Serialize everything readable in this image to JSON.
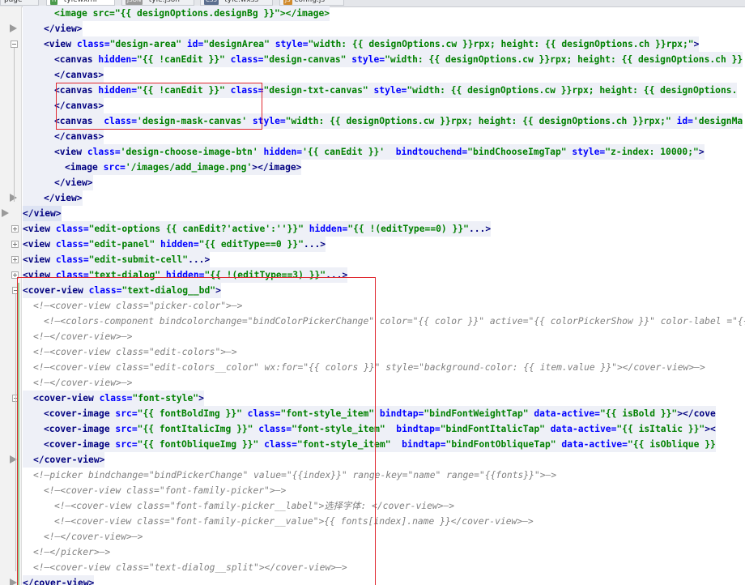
{
  "tabs": [
    {
      "label": "page",
      "icon": "",
      "color": "#6a8ed1"
    },
    {
      "label": "*tylewxml",
      "icon": "H",
      "color": "#4a9a4a"
    },
    {
      "label": "*tyle.json",
      "icon": "JSON",
      "color": "#999999"
    },
    {
      "label": "*tyle.wxss",
      "icon": "CSS",
      "color": "#5b6e8e"
    },
    {
      "label": "config.js",
      "icon": "JS",
      "color": "#d08a2a"
    }
  ],
  "colors": {
    "tag": "#000080",
    "attribute": "#0000ff",
    "value": "#008000",
    "comment": "#808080",
    "annotation": "#e0282f",
    "gutter_change": "#96cf96"
  },
  "code_lines": [
    {
      "kind": "hl",
      "indent": 6,
      "tokens": [
        [
          "v",
          "<image src=\"{{ designOptions.designBg }}\"></image>"
        ]
      ]
    },
    {
      "kind": "hl",
      "indent": 4,
      "tokens": [
        [
          "t",
          "</view>"
        ]
      ]
    },
    {
      "kind": "hl",
      "indent": 4,
      "tokens": [
        [
          "t",
          "<view "
        ],
        [
          "a",
          "class="
        ],
        [
          "v",
          "\"design-area\""
        ],
        [
          "a",
          " id="
        ],
        [
          "v",
          "\"designArea\""
        ],
        [
          "a",
          " style="
        ],
        [
          "v",
          "\"width: {{ designOptions.cw }}rpx; height: {{ designOptions.ch }}rpx;\""
        ],
        [
          "t",
          ">"
        ]
      ]
    },
    {
      "kind": "hl",
      "indent": 6,
      "tokens": [
        [
          "t",
          "<canvas "
        ],
        [
          "a",
          "hidden="
        ],
        [
          "v",
          "\"{{ !canEdit }}\""
        ],
        [
          "a",
          " class="
        ],
        [
          "v",
          "\"design-canvas\""
        ],
        [
          "a",
          " style="
        ],
        [
          "v",
          "\"width: {{ designOptions.cw }}rpx; height: {{ designOptions.ch }}"
        ]
      ]
    },
    {
      "kind": "hl",
      "indent": 6,
      "tokens": [
        [
          "t",
          "</canvas>"
        ]
      ]
    },
    {
      "kind": "hl",
      "indent": 6,
      "tokens": [
        [
          "t",
          "<canvas "
        ],
        [
          "a",
          "hidden="
        ],
        [
          "v",
          "\"{{ !canEdit }}\""
        ],
        [
          "a",
          " class="
        ],
        [
          "v",
          "\"design-txt-canvas\""
        ],
        [
          "a",
          " style="
        ],
        [
          "v",
          "\"width: {{ designOptions.cw }}rpx; height: {{ designOptions."
        ]
      ]
    },
    {
      "kind": "hl",
      "indent": 6,
      "tokens": [
        [
          "t",
          "</canvas>"
        ]
      ]
    },
    {
      "kind": "hl",
      "indent": 6,
      "tokens": [
        [
          "t",
          "<canvas  "
        ],
        [
          "a",
          "class="
        ],
        [
          "v",
          "'design-mask-canvas'"
        ],
        [
          "a",
          " style="
        ],
        [
          "v",
          "\"width: {{ designOptions.cw }}rpx; height: {{ designOptions.ch }}rpx;\""
        ],
        [
          "a",
          " id="
        ],
        [
          "v",
          "'designMa"
        ]
      ]
    },
    {
      "kind": "hl",
      "indent": 6,
      "tokens": [
        [
          "t",
          "</canvas>"
        ]
      ]
    },
    {
      "kind": "hl",
      "indent": 6,
      "tokens": [
        [
          "t",
          "<view "
        ],
        [
          "a",
          "class="
        ],
        [
          "v",
          "'design-choose-image-btn'"
        ],
        [
          "a",
          " hidden="
        ],
        [
          "v",
          "'{{ canEdit }}'"
        ],
        [
          "a",
          "  bindtouchend="
        ],
        [
          "v",
          "\"bindChooseImgTap\""
        ],
        [
          "a",
          " style="
        ],
        [
          "v",
          "\"z-index: 10000;\""
        ],
        [
          "t",
          ">"
        ]
      ]
    },
    {
      "kind": "hl",
      "indent": 8,
      "tokens": [
        [
          "t",
          "<image "
        ],
        [
          "a",
          "src="
        ],
        [
          "v",
          "'/images/add_image.png'"
        ],
        [
          "t",
          "></image>"
        ]
      ]
    },
    {
      "kind": "hl",
      "indent": 6,
      "tokens": [
        [
          "t",
          "</view>"
        ]
      ]
    },
    {
      "kind": "hl",
      "indent": 4,
      "tokens": [
        [
          "t",
          "</view>"
        ]
      ]
    },
    {
      "kind": "cur",
      "indent": 0,
      "tokens": [
        [
          "t",
          "</view>"
        ]
      ]
    },
    {
      "kind": "hl",
      "indent": 0,
      "tokens": [
        [
          "t",
          "<view "
        ],
        [
          "a",
          "class="
        ],
        [
          "v",
          "\"edit-options {{ canEdit?'active':''}}\""
        ],
        [
          "a",
          " hidden="
        ],
        [
          "v",
          "\"{{ !(editType==0) }}\""
        ],
        [
          "t",
          "..."
        ],
        [
          "t",
          ">"
        ]
      ]
    },
    {
      "kind": "hl",
      "indent": 0,
      "tokens": [
        [
          "t",
          "<view "
        ],
        [
          "a",
          "class="
        ],
        [
          "v",
          "\"edit-panel\""
        ],
        [
          "a",
          " hidden="
        ],
        [
          "v",
          "\"{{ editType==0 }}\""
        ],
        [
          "t",
          "...>"
        ]
      ]
    },
    {
      "kind": "hl",
      "indent": 0,
      "tokens": [
        [
          "t",
          "<view "
        ],
        [
          "a",
          "class="
        ],
        [
          "v",
          "\"edit-submit-cell\""
        ],
        [
          "t",
          "...>"
        ]
      ]
    },
    {
      "kind": "hl",
      "indent": 0,
      "tokens": [
        [
          "t",
          "<view "
        ],
        [
          "a",
          "class="
        ],
        [
          "v",
          "\"text-dialog\""
        ],
        [
          "a",
          " hidden="
        ],
        [
          "v",
          "\"{{ !(editType==3) }}\""
        ],
        [
          "t",
          "...>"
        ]
      ]
    },
    {
      "kind": "hl",
      "indent": 0,
      "tokens": [
        [
          "t",
          "<cover-view "
        ],
        [
          "a",
          "class="
        ],
        [
          "v",
          "\"text-dialog__bd\""
        ],
        [
          "t",
          ">"
        ]
      ]
    },
    {
      "kind": "cmt",
      "indent": 2,
      "tokens": [
        [
          "c",
          "<!—<cover-view class=\"picker-color\">—>"
        ]
      ]
    },
    {
      "kind": "cmt",
      "indent": 4,
      "tokens": [
        [
          "c",
          "<!—<colors-component bindcolorchange=\"bindColorPickerChange\" color=\"{{ color }}\" active=\"{{ colorPickerShow }}\" color-label =\"{{ false }}\" c"
        ]
      ]
    },
    {
      "kind": "cmt",
      "indent": 2,
      "tokens": [
        [
          "c",
          "<!—</cover-view>—>"
        ]
      ]
    },
    {
      "kind": "cmt",
      "indent": 2,
      "tokens": [
        [
          "c",
          "<!—<cover-view class=\"edit-colors\">—>"
        ]
      ]
    },
    {
      "kind": "cmt",
      "indent": 2,
      "tokens": [
        [
          "c",
          "<!—<cover-view class=\"edit-colors__color\" wx:for=\"{{ colors }}\" style=\"background-color: {{ item.value }}\"></cover-view>—>"
        ]
      ]
    },
    {
      "kind": "cmt",
      "indent": 2,
      "tokens": [
        [
          "c",
          "<!—</cover-view>—>"
        ]
      ]
    },
    {
      "kind": "hl",
      "indent": 2,
      "tokens": [
        [
          "t",
          "<cover-view "
        ],
        [
          "a",
          "class="
        ],
        [
          "v",
          "\"font-style\""
        ],
        [
          "t",
          ">"
        ]
      ]
    },
    {
      "kind": "hl",
      "indent": 4,
      "tokens": [
        [
          "t",
          "<cover-image "
        ],
        [
          "a",
          "src="
        ],
        [
          "v",
          "\"{{ fontBoldImg }}\""
        ],
        [
          "a",
          " class="
        ],
        [
          "v",
          "\"font-style_item\""
        ],
        [
          "a",
          " bindtap="
        ],
        [
          "v",
          "\"bindFontWeightTap\""
        ],
        [
          "a",
          " data-active="
        ],
        [
          "v",
          "\"{{ isBold }}\""
        ],
        [
          "t",
          "></cove"
        ]
      ]
    },
    {
      "kind": "hl",
      "indent": 4,
      "tokens": [
        [
          "t",
          "<cover-image "
        ],
        [
          "a",
          "src="
        ],
        [
          "v",
          "\"{{ fontItalicImg }}\""
        ],
        [
          "a",
          " class="
        ],
        [
          "v",
          "\"font-style_item\""
        ],
        [
          "a",
          "  bindtap="
        ],
        [
          "v",
          "\"bindFontItalicTap\""
        ],
        [
          "a",
          " data-active="
        ],
        [
          "v",
          "\"{{ isItalic }}\""
        ],
        [
          "t",
          "><"
        ]
      ]
    },
    {
      "kind": "hl",
      "indent": 4,
      "tokens": [
        [
          "t",
          "<cover-image "
        ],
        [
          "a",
          "src="
        ],
        [
          "v",
          "\"{{ fontObliqueImg }}\""
        ],
        [
          "a",
          " class="
        ],
        [
          "v",
          "\"font-style_item\""
        ],
        [
          "a",
          "  bindtap="
        ],
        [
          "v",
          "\"bindFontObliqueTap\""
        ],
        [
          "a",
          " data-active="
        ],
        [
          "v",
          "\"{{ isOblique }}"
        ]
      ]
    },
    {
      "kind": "hl",
      "indent": 2,
      "tokens": [
        [
          "t",
          "</cover-view>"
        ]
      ]
    },
    {
      "kind": "cmt",
      "indent": 2,
      "tokens": [
        [
          "c",
          "<!—picker bindchange=\"bindPickerChange\" value=\"{{index}}\" range-key=\"name\" range=\"{{fonts}}\">—>"
        ]
      ]
    },
    {
      "kind": "cmt",
      "indent": 4,
      "tokens": [
        [
          "c",
          "<!—<cover-view class=\"font-family-picker\">—>"
        ]
      ]
    },
    {
      "kind": "cmt",
      "indent": 6,
      "tokens": [
        [
          "c",
          "<!—<cover-view class=\"font-family-picker__label\">选择字体: </cover-view>—>"
        ]
      ]
    },
    {
      "kind": "cmt",
      "indent": 6,
      "tokens": [
        [
          "c",
          "<!—<cover-view class=\"font-family-picker__value\">{{ fonts[index].name }}</cover-view>—>"
        ]
      ]
    },
    {
      "kind": "cmt",
      "indent": 4,
      "tokens": [
        [
          "c",
          "<!—</cover-view>—>"
        ]
      ]
    },
    {
      "kind": "cmt",
      "indent": 2,
      "tokens": [
        [
          "c",
          "<!—</picker>—>"
        ]
      ]
    },
    {
      "kind": "cmt",
      "indent": 2,
      "tokens": [
        [
          "c",
          "<!—<cover-view class=\"text-dialog__split\"></cover-view>—>"
        ]
      ]
    },
    {
      "kind": "hl",
      "indent": 0,
      "tokens": [
        [
          "t",
          "</cover-view>"
        ]
      ]
    }
  ]
}
